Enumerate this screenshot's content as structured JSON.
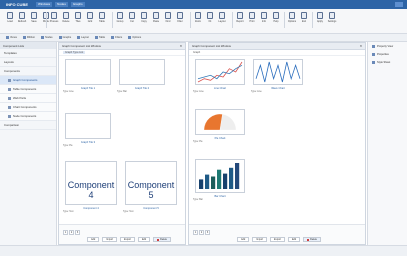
{
  "titlebar": {
    "title": "INFO CUBE",
    "tags": [
      "Windows",
      "Nodes",
      "Graphs"
    ]
  },
  "ribbon": {
    "buttons": [
      "Load",
      "Refresh",
      "Save",
      "Mode",
      "Process",
      "Delete",
      "Tiles",
      "Grid",
      "Table",
      "Group",
      "Cut",
      "Copy",
      "Paste",
      "Find",
      "Filter",
      "Zoom",
      "Fit",
      "Layout",
      "Report",
      "Print",
      "Info",
      "Help",
      "Options",
      "Exit",
      "Apply",
      "Settings"
    ]
  },
  "quickbar": [
    "Views",
    "Ribbon",
    "Nodes",
    "Graphs",
    "Layout",
    "Table",
    "Filters",
    "Options"
  ],
  "leftnav": {
    "header": "Component Lists",
    "items": [
      "Templates",
      "Layouts",
      "Components",
      "Graph Components",
      "Table Components",
      "Web Parts",
      "Chart Components",
      "Node Components",
      "Comparison"
    ]
  },
  "center": {
    "header": "Graph Component List Window",
    "chip": "Graph Type List",
    "tiles": [
      {
        "name": "Graph Tile 1",
        "meta": "Type: Line"
      },
      {
        "name": "Graph Tile 2",
        "meta": "Type: Bar"
      },
      {
        "name": "Graph Tile 3",
        "meta": "Type: Pie"
      },
      {
        "name": "Component 4",
        "meta": "Type: Text"
      },
      {
        "name": "Component 5",
        "meta": "Type: Text"
      }
    ],
    "pager": [
      "1",
      "2",
      "3"
    ],
    "buttons": [
      "Add",
      "Import",
      "Export",
      "Edit",
      "Delete"
    ]
  },
  "right": {
    "header": "Graph Component List Window",
    "chip": "Graph",
    "tiles": [
      {
        "name": "Line Chart",
        "meta": "Type: Line"
      },
      {
        "name": "Wave Chart",
        "meta": "Type: Line"
      },
      {
        "name": "Pie Chart",
        "meta": "Type: Pie"
      },
      {
        "name": "Bar Chart",
        "meta": "Type: Bar"
      }
    ],
    "pager": [
      "1",
      "2",
      "3"
    ],
    "buttons": [
      "Add",
      "Import",
      "Export",
      "Edit",
      "Delete"
    ]
  },
  "rightpane": [
    "Property View",
    "Properties",
    "Style Sheet"
  ],
  "chart_data": [
    {
      "type": "line",
      "series": [
        {
          "values": [
            2,
            3,
            2.5,
            4,
            3.5,
            6,
            5,
            8
          ]
        },
        {
          "values": [
            3,
            3.5,
            4,
            3,
            5,
            4.5,
            6,
            7
          ]
        }
      ],
      "colors": [
        "#d9534f",
        "#337ab7"
      ]
    },
    {
      "type": "line",
      "series": [
        {
          "values": [
            3,
            7,
            2,
            8,
            3,
            7,
            2,
            8,
            3,
            7,
            3
          ]
        }
      ],
      "colors": [
        "#2a6dbd"
      ]
    },
    {
      "type": "pie",
      "values": [
        55,
        45
      ],
      "colors": [
        "#e8762f",
        "#eeeeee"
      ]
    },
    {
      "type": "bar",
      "categories": [
        "A",
        "B",
        "C",
        "D",
        "E",
        "F",
        "G"
      ],
      "values": [
        10,
        15,
        13,
        20,
        16,
        22,
        27
      ],
      "colors": [
        "#17416d",
        "#1f5a86",
        "#1b5d5a",
        "#1e7a73",
        "#17416d",
        "#1f5a86",
        "#24497a"
      ]
    }
  ]
}
